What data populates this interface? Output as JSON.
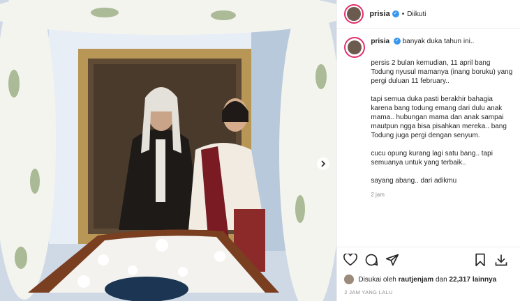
{
  "post": {
    "username": "prisia",
    "follow_status": "Diikuti",
    "caption": {
      "username": "prisia",
      "first_line": "banyak duka tahun ini..",
      "paragraphs": [
        "persis 2 bulan kemudian, 11 april bang Todung nyusul mamanya (inang boruku) yang pergi duluan 11 february..",
        "tapi semua duka pasti berakhir bahagia karena bang todung emang dari dulu anak mama.. hubungan mama dan anak sampai mautpun ngga bisa pisahkan mereka.. bang Todung juga pergi dengan senyum.",
        "cucu opung kurang lagi satu bang.. tapi semuanya untuk yang terbaik..",
        "sayang abang.. dari adikmu"
      ],
      "caption_time": "2 jam"
    },
    "likes": {
      "prefix": "Disukai oleh",
      "user": "rautjenjam",
      "middle": "dan",
      "count": "22,317 lainnya"
    },
    "timestamp": "2 JAM YANG LALU",
    "icons": [
      "heart-icon",
      "comment-icon",
      "share-icon",
      "bookmark-icon",
      "download-icon"
    ],
    "colors": {
      "verified": "#3897f0",
      "story_ring": "#e1306c"
    }
  }
}
